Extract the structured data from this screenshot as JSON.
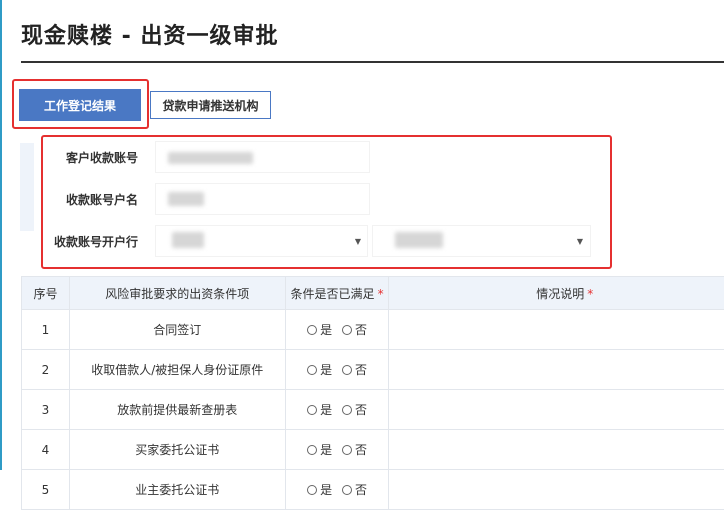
{
  "page": {
    "title": "现金赎楼 - 出资一级审批"
  },
  "tabs": [
    {
      "label": "工作登记结果",
      "active": true
    },
    {
      "label": "贷款申请推送机构",
      "active": false
    }
  ],
  "form": {
    "account_no_label": "客户收款账号",
    "account_name_label": "收款账号户名",
    "bank_label": "收款账号开户行"
  },
  "table": {
    "headers": {
      "index": "序号",
      "item": "风险审批要求的出资条件项",
      "satisfied": "条件是否已满足",
      "remark": "情况说明",
      "required_mark": "*"
    },
    "options": {
      "yes": "是",
      "no": "否"
    },
    "rows": [
      {
        "index": "1",
        "item": "合同签订"
      },
      {
        "index": "2",
        "item": "收取借款人/被担保人身份证原件"
      },
      {
        "index": "3",
        "item": "放款前提供最新查册表"
      },
      {
        "index": "4",
        "item": "买家委托公证书"
      },
      {
        "index": "5",
        "item": "业主委托公证书"
      }
    ]
  },
  "colors": {
    "accent": "#4a78c4",
    "highlight": "#e53030",
    "header_bg": "#eef3fa"
  }
}
